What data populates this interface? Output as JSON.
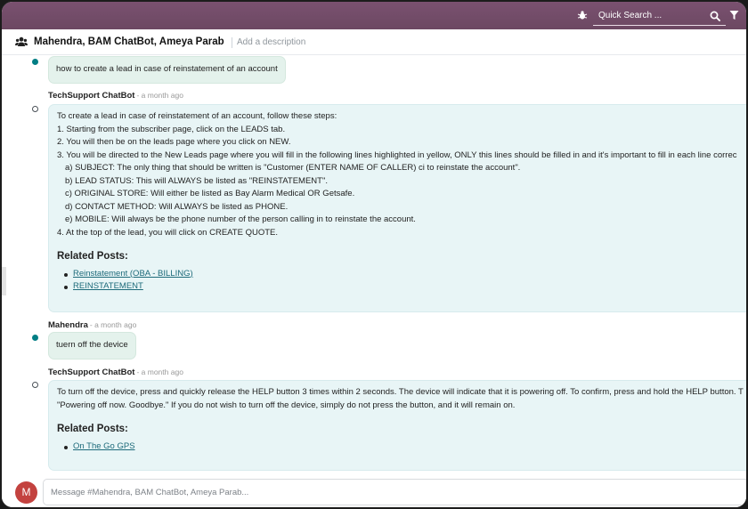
{
  "topbar": {
    "quick_search_placeholder": "Quick Search ...",
    "icons": [
      "bug-icon",
      "search-icon",
      "filter-icon"
    ],
    "color": "#714b67"
  },
  "header": {
    "channel_name": "Mahendra, BAM ChatBot, Ameya Parab",
    "add_description": "Add a description"
  },
  "messages": [
    {
      "text": "how to create a lead in case of reinstatement of an account"
    },
    {
      "author": "TechSupport ChatBot",
      "ago": "- a month ago",
      "lines": [
        "To create a lead in case of reinstatement of an account, follow these steps:",
        "1. Starting from the subscriber page, click on the LEADS tab.",
        "2. You will then be on the leads page where you click on NEW.",
        "3. You will be directed to the New Leads page where you will fill in the following lines highlighted in yellow, ONLY this lines should be filled in and it's important to fill in each line correc",
        "a) SUBJECT: The only thing that should be written is \"Customer (ENTER NAME OF CALLER) ci to reinstate the account\".",
        "b) LEAD STATUS: This will ALWAYS be listed as \"REINSTATEMENT\".",
        "c) ORIGINAL STORE: Will either be listed as Bay Alarm Medical OR Getsafe.",
        "d) CONTACT METHOD: Will ALWAYS be listed as PHONE.",
        "e) MOBILE: Will always be the phone number of the person calling in to reinstate the account.",
        "4. At the top of the lead, you will click on CREATE QUOTE."
      ],
      "related_title": "Related Posts:",
      "related": [
        "Reinstatement (OBA - BILLING)",
        "REINSTATEMENT"
      ]
    },
    {
      "author": "Mahendra",
      "ago": "- a month ago",
      "text": "tuern off the device"
    },
    {
      "author": "TechSupport ChatBot",
      "ago": "- a month ago",
      "lines": [
        "To turn off the device, press and quickly release the HELP button 3 times within 2 seconds. The device will indicate that it is powering off. To confirm, press and hold the HELP button. T",
        "\"Powering off now. Goodbye.\" If you do not wish to turn off the device, simply do not press the button, and it will remain on."
      ],
      "related_title": "Related Posts:",
      "related": [
        "On The Go GPS"
      ]
    }
  ],
  "composer": {
    "avatar_initial": "M",
    "avatar_color": "#c3423f",
    "placeholder": "Message #Mahendra, BAM ChatBot, Ameya Parab..."
  }
}
